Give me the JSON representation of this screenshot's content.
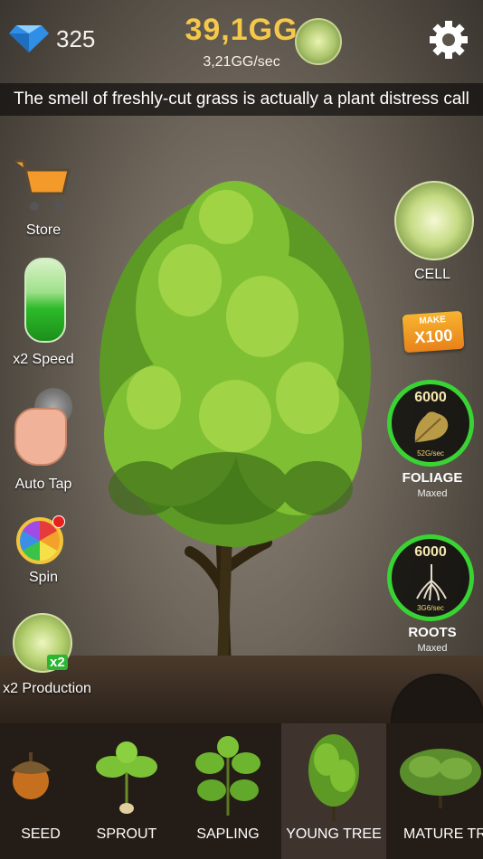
{
  "header": {
    "gems": "325",
    "currency": "39,1GG",
    "rate": "3,21GG/sec"
  },
  "fact": "The smell of freshly-cut grass is actually a plant distress call",
  "left_menu": {
    "store": "Store",
    "speed": "x2 Speed",
    "auto_tap": "Auto Tap",
    "spin": "Spin",
    "production": "x2 Production",
    "production_badge": "x2"
  },
  "right_menu": {
    "cell": "CELL",
    "make_top": "MAKE",
    "make_bottom": "X100",
    "foliage": {
      "level": "6000",
      "rate": "52G/sec",
      "label": "FOLIAGE",
      "status": "Maxed",
      "progress": 1.0
    },
    "roots": {
      "level": "6000",
      "rate": "3G6/sec",
      "label": "ROOTS",
      "status": "Maxed",
      "progress": 1.0
    }
  },
  "stages": [
    {
      "label": "SEED"
    },
    {
      "label": "SPROUT"
    },
    {
      "label": "SAPLING"
    },
    {
      "label": "YOUNG TREE",
      "selected": true
    },
    {
      "label": "MATURE TRE"
    }
  ],
  "colors": {
    "accent_gold": "#f5c84a",
    "ring_green": "#39d433",
    "leaf_green": "#6fb52c"
  }
}
